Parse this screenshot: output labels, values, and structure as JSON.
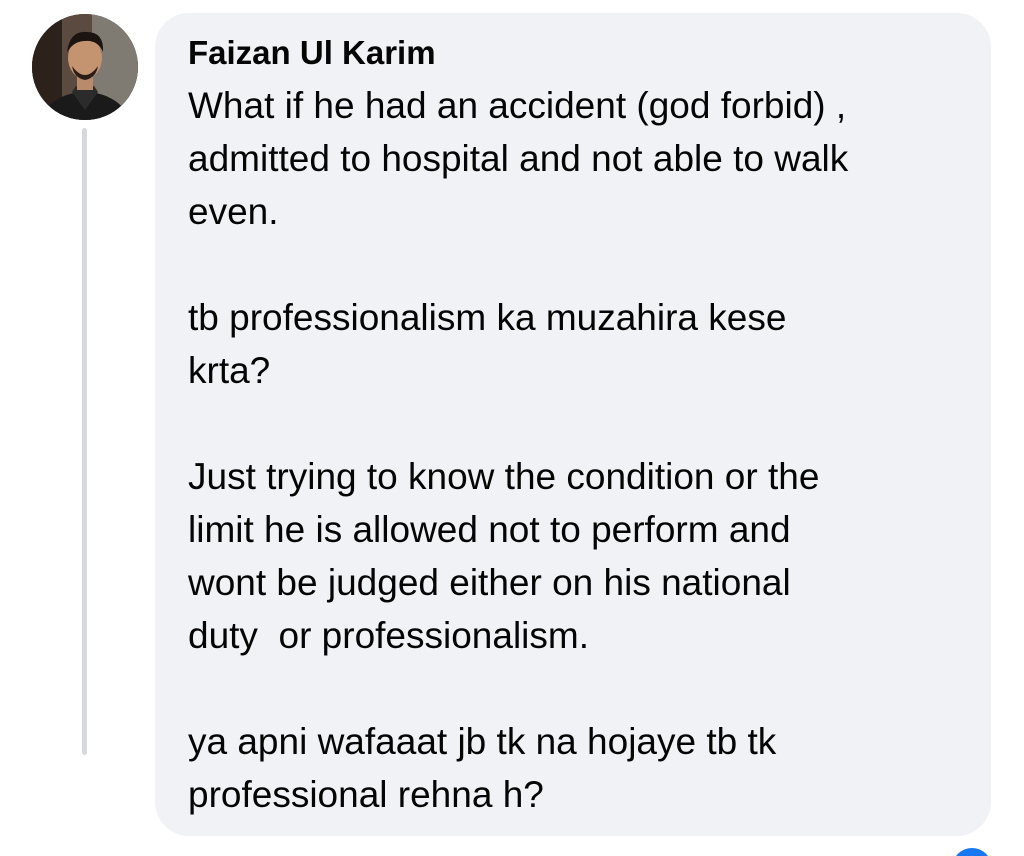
{
  "comment": {
    "author": "Faizan Ul Karim",
    "paragraphs": [
      "What if he had an accident (god forbid) ,\nadmitted to hospital and not able to walk\neven.",
      "tb professionalism ka muzahira kese\nkrta?",
      "Just trying to know the condition or the\nlimit he is allowed not to perform and\nwont be judged either on his national\nduty  or professionalism.",
      "ya apni wafaaat jb tk na hojaye tb tk\nprofessional rehna h?"
    ]
  },
  "colors": {
    "bubble_bg": "#f0f2f5",
    "text": "#050505",
    "thread_line": "#d6d8dc",
    "accent": "#1877f2"
  },
  "icons": {
    "avatar": "profile-photo",
    "corner": "reaction-badge"
  }
}
